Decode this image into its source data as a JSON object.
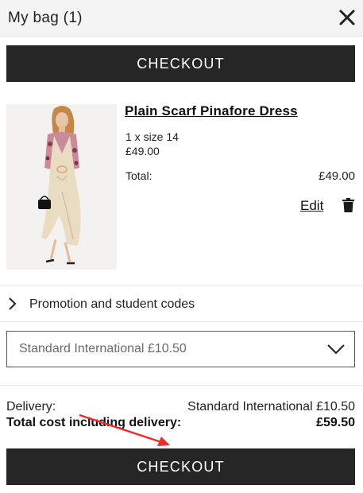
{
  "header": {
    "title": "My bag (1)",
    "close_icon": "close-icon"
  },
  "buttons": {
    "checkout_top": "CHECKOUT",
    "checkout_bottom": "CHECKOUT"
  },
  "item": {
    "name": "Plain Scarf Pinafore Dress",
    "quantity_size": "1 x size 14",
    "price": "£49.00",
    "total_label": "Total:",
    "total_value": "£49.00",
    "edit_label": "Edit",
    "delete_icon": "trash-icon",
    "image_icon": "product-photo"
  },
  "promo": {
    "label": "Promotion and student codes",
    "icon": "chevron-right-icon"
  },
  "delivery": {
    "selected": "Standard International £10.50",
    "select_icon": "chevron-down-icon",
    "delivery_label": "Delivery:",
    "delivery_value": "Standard International £10.50",
    "total_cost_label": "Total cost including delivery:",
    "total_cost_value": "£59.50"
  },
  "colors": {
    "button_bg": "#262626",
    "annotation_arrow": "#e8302a"
  }
}
